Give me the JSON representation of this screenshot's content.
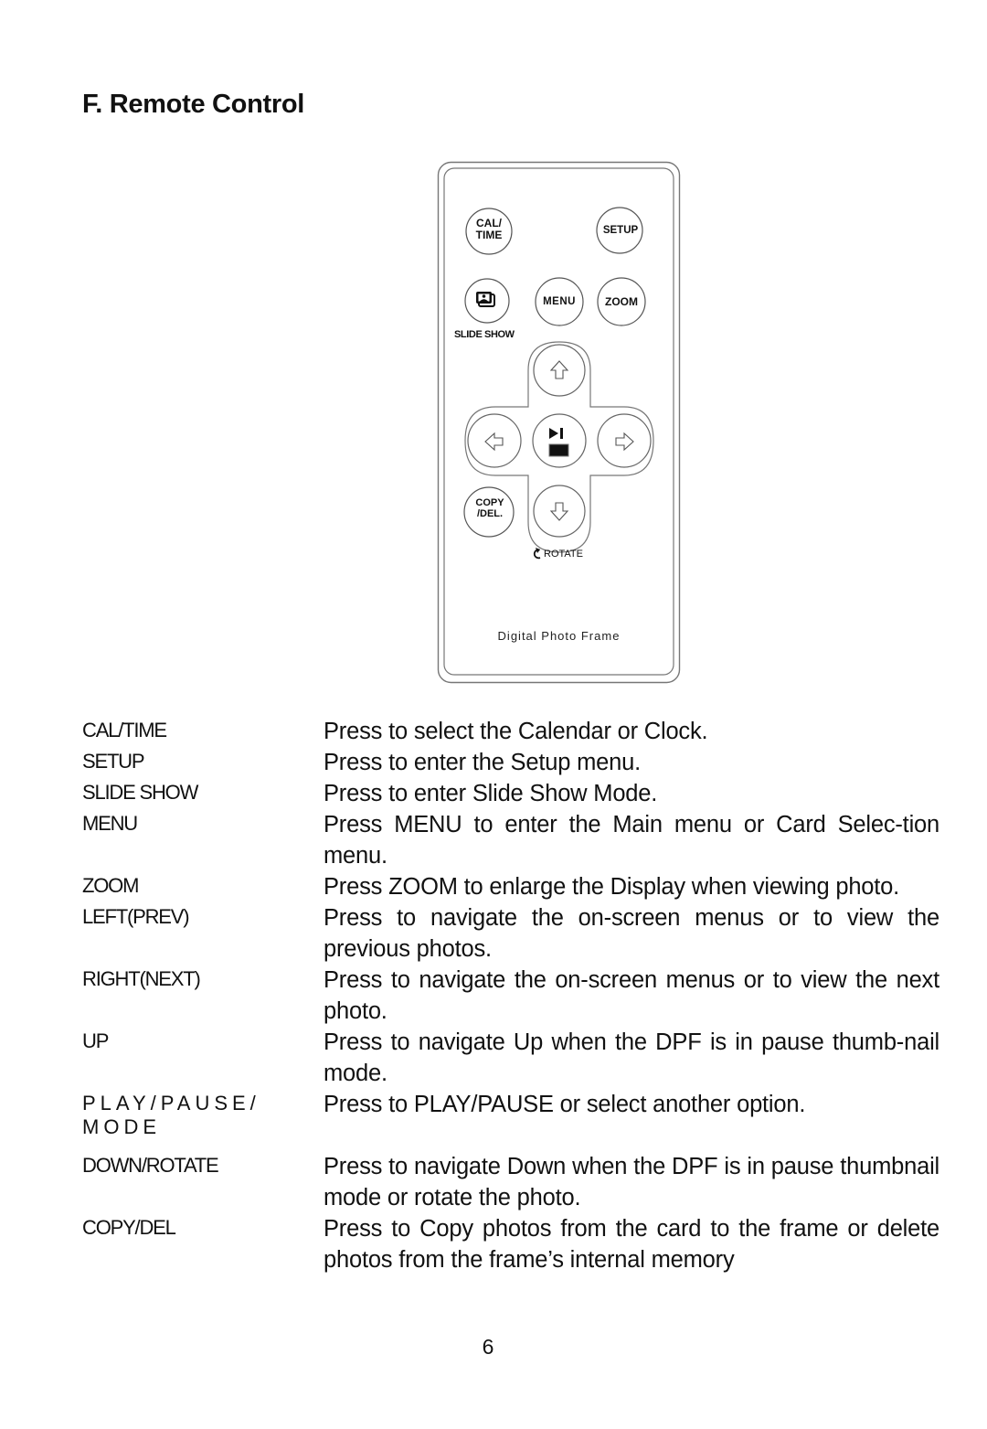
{
  "page": {
    "title": "F. Remote Control",
    "page_number": "6"
  },
  "remote": {
    "buttons": {
      "cal_time_line1": "CAL/",
      "cal_time_line2": "TIME",
      "setup": "SETUP",
      "menu": "MENU",
      "zoom": "ZOOM",
      "copy_del_line1": "COPY",
      "copy_del_line2": "/DEL."
    },
    "labels": {
      "slide_show": "SLIDE SHOW",
      "rotate": "ROTATE",
      "brand": "Digital Photo Frame"
    },
    "icons": {
      "slide_show": "photo-stack-icon",
      "up": "arrow-up-icon",
      "down": "arrow-down-icon",
      "left": "arrow-left-icon",
      "right": "arrow-right-icon",
      "play_pause": "play-pause-icon",
      "stop": "stop-icon",
      "rotate": "rotate-icon"
    }
  },
  "functions": [
    {
      "key": "CAL/TIME",
      "description": "Press to select the Calendar or Clock."
    },
    {
      "key": "SETUP",
      "description": "Press to enter the Setup menu."
    },
    {
      "key": "SLIDE SHOW",
      "description": "Press to enter Slide Show Mode."
    },
    {
      "key": "MENU",
      "description": "Press MENU to enter the Main menu or Card Selec-tion menu."
    },
    {
      "key": "ZOOM",
      "description": "Press ZOOM to enlarge the Display when viewing photo."
    },
    {
      "key": "LEFT(PREV)",
      "description": "Press to navigate the on-screen menus or to view the previous photos."
    },
    {
      "key": "RIGHT(NEXT)",
      "description": "Press to navigate the on-screen menus or to view the next photo."
    },
    {
      "key": "UP",
      "description": "Press to navigate Up when the DPF is in pause thumb-nail mode."
    },
    {
      "key": "PLAY/PAUSE/ MODE",
      "description": "Press to PLAY/PAUSE or select another option."
    },
    {
      "key": "DOWN/ROTATE",
      "description": "Press to navigate Down when the DPF is in pause thumbnail mode or rotate the photo."
    },
    {
      "key": "COPY/DEL",
      "description": "Press to  Copy photos from the card to the frame or delete photos from the frame’s internal memory"
    }
  ]
}
